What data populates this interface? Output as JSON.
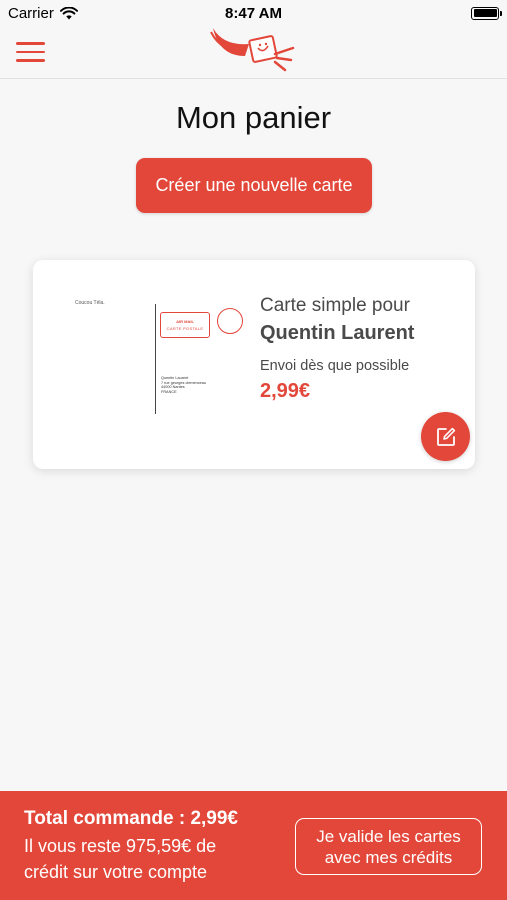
{
  "status_bar": {
    "carrier": "Carrier",
    "time": "8:47 AM"
  },
  "nav": {
    "menu_icon": "hamburger-menu-icon",
    "logo_icon": "flying-stamp-logo-icon"
  },
  "page": {
    "title": "Mon panier",
    "create_button_label": "Créer une nouvelle carte"
  },
  "cart": {
    "items": [
      {
        "line1": "Carte simple pour",
        "recipient": "Quentin Laurent",
        "delivery": "Envoi dès que possible",
        "price": "2,99€",
        "thumbnail": {
          "from": "Coucou Téla.",
          "stamp_line1": "AIR MAIL",
          "stamp_line2": "CARTE POSTALE",
          "address_lines": [
            "Quentin Laurent",
            "7 rue georges clemenceau",
            "44000 Nantes",
            "FRANCE"
          ]
        },
        "edit_icon": "edit-pencil-icon"
      }
    ]
  },
  "footer": {
    "total": "Total commande : 2,99€",
    "credit_line1": "Il vous reste 975,59€ de",
    "credit_line2": "crédit sur votre compte",
    "validate_line1": "Je valide les cartes",
    "validate_line2": "avec mes crédits"
  },
  "colors": {
    "accent": "#e2473a",
    "background": "#f7f7f7"
  }
}
